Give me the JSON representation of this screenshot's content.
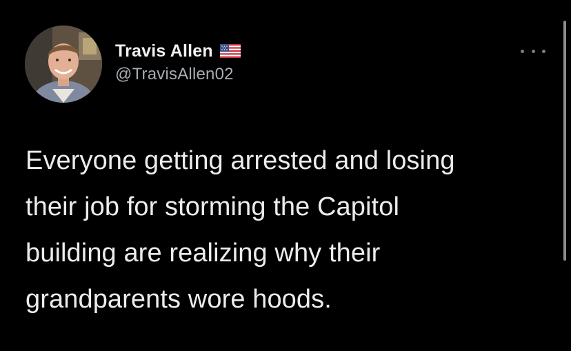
{
  "tweet": {
    "author": {
      "display_name": "Travis Allen",
      "handle": "@TravisAllen02",
      "flag_icon": "us-flag-icon"
    },
    "text": "Everyone getting arrested and losing\ntheir job for storming the Capitol\nbuilding are realizing why their\ngrandparents wore hoods.",
    "more_icon": "more-options-icon"
  },
  "colors": {
    "background": "#000000",
    "name": "#f1f1f1",
    "handle": "#a6acb2",
    "text": "#ececec"
  }
}
